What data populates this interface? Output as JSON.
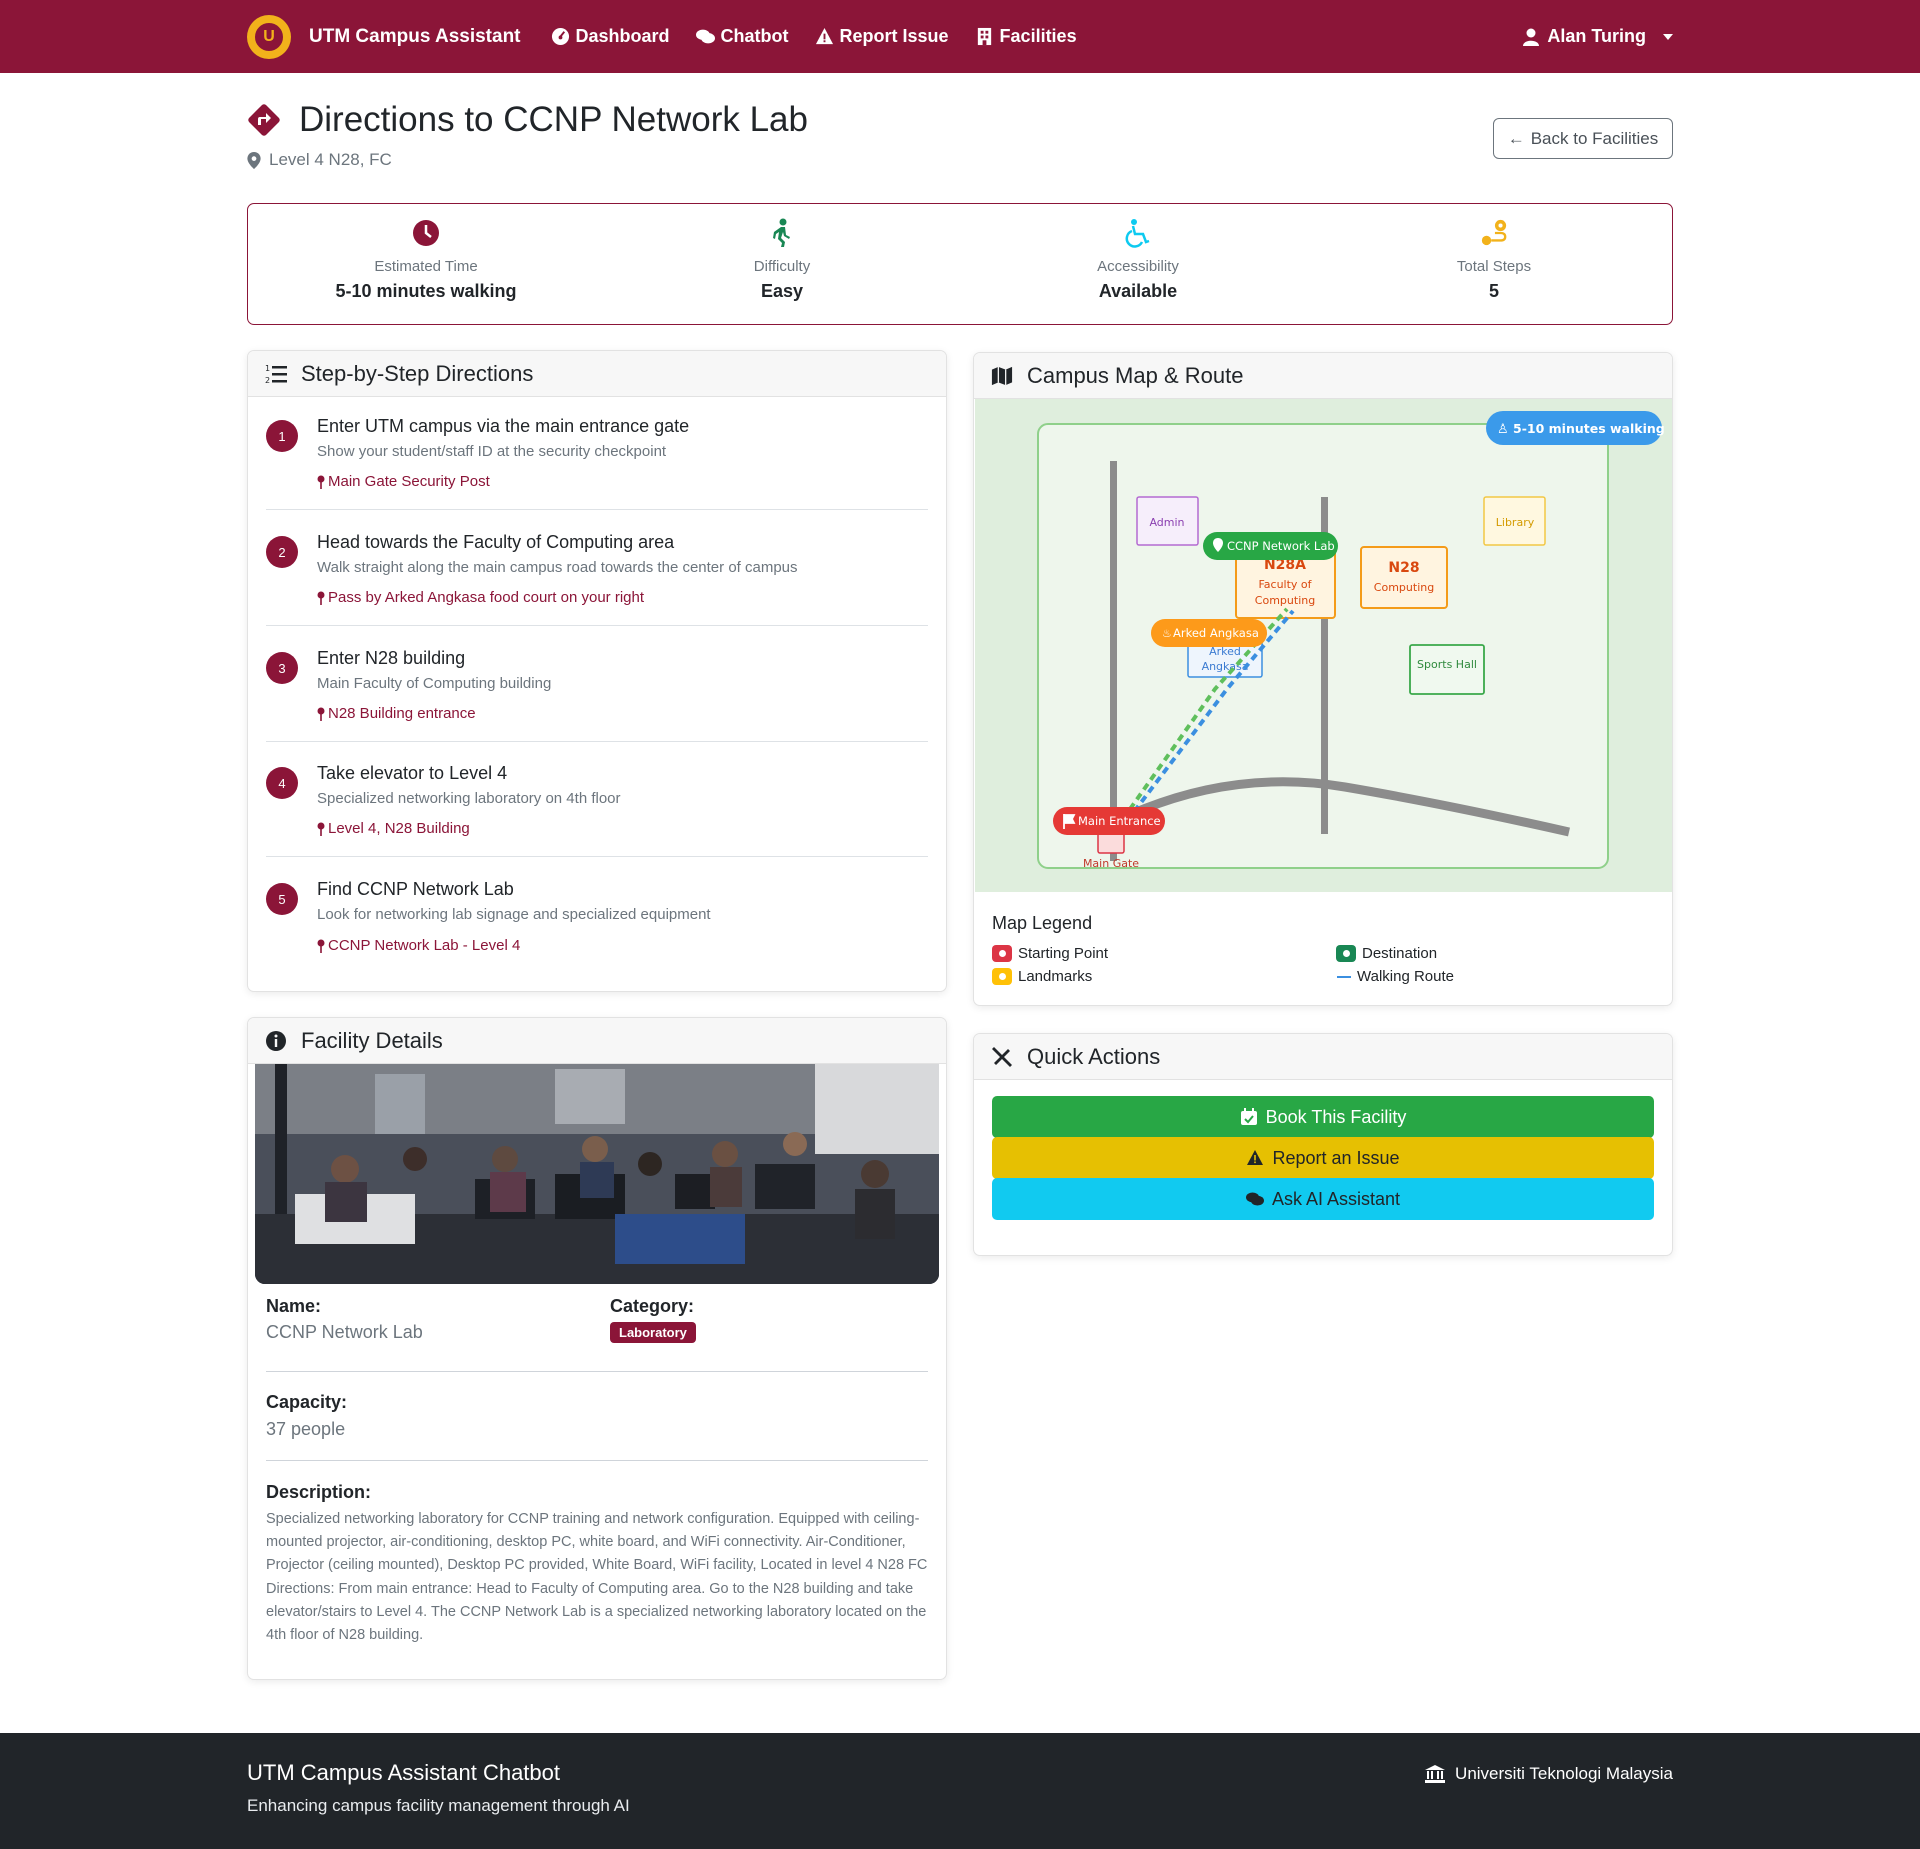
{
  "nav": {
    "brand": "UTM Campus Assistant",
    "links": [
      {
        "label": "Dashboard",
        "icon": "gauge-icon"
      },
      {
        "label": "Chatbot",
        "icon": "chat-icon"
      },
      {
        "label": "Report Issue",
        "icon": "warning-icon"
      },
      {
        "label": "Facilities",
        "icon": "building-icon"
      }
    ],
    "user": "Alan Turing"
  },
  "header": {
    "title": "Directions to CCNP Network Lab",
    "location": "Level 4 N28, FC",
    "back_label": "Back to Facilities"
  },
  "summary": [
    {
      "label": "Estimated Time",
      "value": "5-10 minutes walking",
      "icon": "clock-icon",
      "color": "#8b1538"
    },
    {
      "label": "Difficulty",
      "value": "Easy",
      "icon": "walking-icon",
      "color": "#198754"
    },
    {
      "label": "Accessibility",
      "value": "Available",
      "icon": "wheelchair-icon",
      "color": "#0dcaf0"
    },
    {
      "label": "Total Steps",
      "value": "5",
      "icon": "route-icon",
      "color": "#f2b21b"
    }
  ],
  "steps_card": {
    "title": "Step-by-Step Directions",
    "steps": [
      {
        "num": "1",
        "title": "Enter UTM campus via the main entrance gate",
        "desc": "Show your student/staff ID at the security checkpoint",
        "loc": "Main Gate Security Post"
      },
      {
        "num": "2",
        "title": "Head towards the Faculty of Computing area",
        "desc": "Walk straight along the main campus road towards the center of campus",
        "loc": "Pass by Arked Angkasa food court on your right"
      },
      {
        "num": "3",
        "title": "Enter N28 building",
        "desc": "Main Faculty of Computing building",
        "loc": "N28 Building entrance"
      },
      {
        "num": "4",
        "title": "Take elevator to Level 4",
        "desc": "Specialized networking laboratory on 4th floor",
        "loc": "Level 4, N28 Building"
      },
      {
        "num": "5",
        "title": "Find CCNP Network Lab",
        "desc": "Look for networking lab signage and specialized equipment",
        "loc": "CCNP Network Lab - Level 4"
      }
    ]
  },
  "facility": {
    "title": "Facility Details",
    "name_label": "Name:",
    "name": "CCNP Network Lab",
    "category_label": "Category:",
    "category": "Laboratory",
    "capacity_label": "Capacity:",
    "capacity": "37 people",
    "description_label": "Description:",
    "description": "Specialized networking laboratory for CCNP training and network configuration. Equipped with ceiling-mounted projector, air-conditioning, desktop PC, white board, and WiFi connectivity. Air-Conditioner, Projector (ceiling mounted), Desktop PC provided, White Board, WiFi facility, Located in level 4 N28 FC Directions: From main entrance: Head to Faculty of Computing area. Go to the N28 building and take elevator/stairs to Level 4. The CCNP Network Lab is a specialized networking laboratory located on the 4th floor of N28 building."
  },
  "map": {
    "title": "Campus Map & Route",
    "walk_badge": "5-10 minutes walking",
    "buildings": {
      "admin": "Admin",
      "library": "Library",
      "n28a": "N28A",
      "n28a_sub1": "Faculty of",
      "n28a_sub2": "Computing",
      "n28": "N28",
      "n28_sub": "Computing",
      "arked1": "Arked",
      "arked2": "Angkasa",
      "sports": "Sports Hall",
      "main_gate": "Main Gate"
    },
    "markers": {
      "destination": "CCNP Network Lab",
      "landmark": "Arked Angkasa",
      "start": "Main Entrance"
    },
    "legend_title": "Map Legend",
    "legend": {
      "start": "Starting Point",
      "destination": "Destination",
      "landmarks": "Landmarks",
      "route": "Walking Route"
    },
    "colors": {
      "start": "#dc3545",
      "destination": "#198754",
      "landmark": "#ffc107",
      "route": "#3b8fe0"
    }
  },
  "quick_actions": {
    "title": "Quick Actions",
    "book": "Book This Facility",
    "report": "Report an Issue",
    "ask": "Ask AI Assistant"
  },
  "footer": {
    "title": "UTM Campus Assistant Chatbot",
    "subtitle": "Enhancing campus facility management through AI",
    "university": "Universiti Teknologi Malaysia"
  }
}
